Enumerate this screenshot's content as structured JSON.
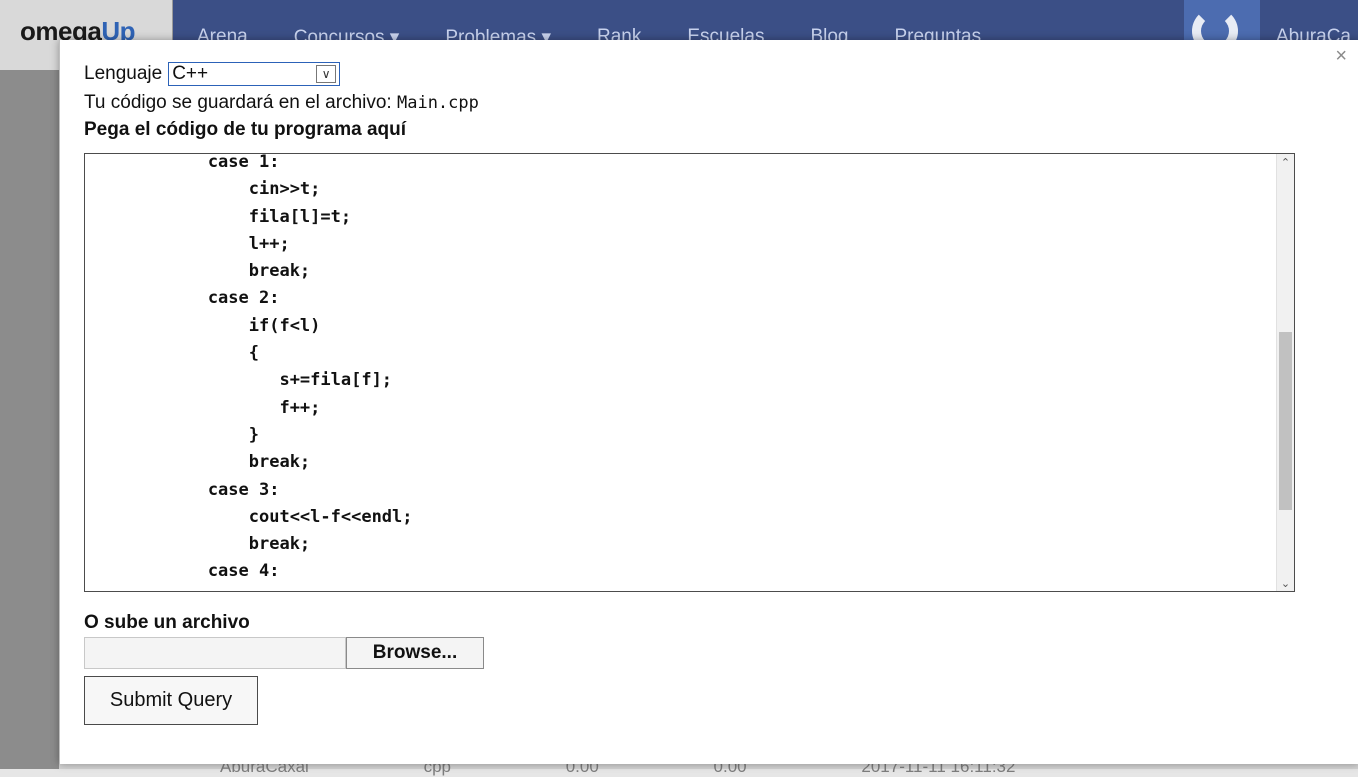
{
  "background": {
    "logo": {
      "omega": "omega",
      "up": "Up"
    },
    "nav": [
      "Arena",
      "Concursos ▾",
      "Problemas ▾",
      "Rank",
      "Escuelas",
      "Blog",
      "Preguntas"
    ],
    "user": "AburaCa",
    "row": [
      "AburaCaxal",
      "cpp",
      "0.00",
      "0.00",
      "2017-11-11 16:11:32"
    ]
  },
  "modal": {
    "close_label": "×",
    "language_label": "Lenguaje",
    "language_value": "C++",
    "file_info_prefix": "Tu código se guardará en el archivo: ",
    "file_name": "Main.cpp",
    "paste_label": "Pega el código de tu programa aquí",
    "code_lines": [
      "            case 1:",
      "                cin>>t;",
      "                fila[l]=t;",
      "                l++;",
      "                break;",
      "            case 2:",
      "                if(f<l)",
      "                {",
      "                   s+=fila[f];",
      "                   f++;",
      "                }",
      "                break;",
      "            case 3:",
      "                cout<<l-f<<endl;",
      "                break;",
      "            case 4:"
    ],
    "upload_label": "O sube un archivo",
    "browse_label": "Browse...",
    "submit_label": "Submit Query"
  },
  "colors": {
    "nav_bg": "#3b4f86",
    "select_border": "#2c62b8"
  }
}
